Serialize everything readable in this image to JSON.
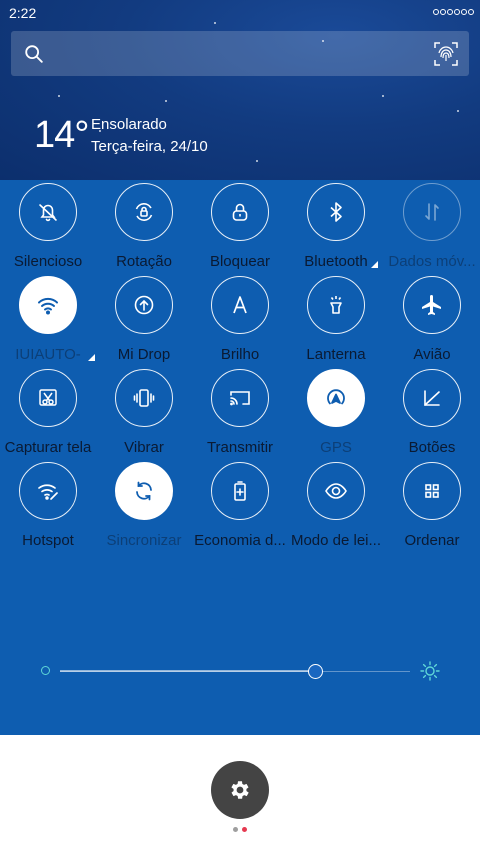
{
  "status_bar": {
    "time": "2:22"
  },
  "search": {
    "placeholder": ""
  },
  "weather": {
    "temperature": "14°",
    "condition": "Ensolarado",
    "date": "Terça-feira, 24/10"
  },
  "toggles": [
    {
      "label": "Silencioso",
      "icon": "bell-off-icon",
      "state": "off"
    },
    {
      "label": "Rotação",
      "icon": "rotation-lock-icon",
      "state": "off"
    },
    {
      "label": "Bloquear",
      "icon": "lock-icon",
      "state": "off"
    },
    {
      "label": "Bluetooth",
      "icon": "bluetooth-icon",
      "state": "off",
      "has_menu": true
    },
    {
      "label": "Dados móv...",
      "icon": "mobile-data-icon",
      "state": "disabled"
    },
    {
      "label": "IUIAUTO-",
      "icon": "wifi-icon",
      "state": "on",
      "has_menu": true
    },
    {
      "label": "Mi Drop",
      "icon": "mi-drop-icon",
      "state": "off"
    },
    {
      "label": "Brilho",
      "icon": "auto-brightness-icon",
      "state": "off"
    },
    {
      "label": "Lanterna",
      "icon": "flashlight-icon",
      "state": "off"
    },
    {
      "label": "Avião",
      "icon": "airplane-icon",
      "state": "off"
    },
    {
      "label": "Capturar tela",
      "icon": "screenshot-icon",
      "state": "off"
    },
    {
      "label": "Vibrar",
      "icon": "vibrate-icon",
      "state": "off"
    },
    {
      "label": "Transmitir",
      "icon": "cast-icon",
      "state": "off"
    },
    {
      "label": "GPS",
      "icon": "gps-icon",
      "state": "on"
    },
    {
      "label": "Botões",
      "icon": "buttons-icon",
      "state": "off"
    },
    {
      "label": "Hotspot",
      "icon": "hotspot-icon",
      "state": "off"
    },
    {
      "label": "Sincronizar",
      "icon": "sync-icon",
      "state": "on"
    },
    {
      "label": "Economia d...",
      "icon": "battery-saver-icon",
      "state": "off"
    },
    {
      "label": "Modo de lei...",
      "icon": "reading-mode-icon",
      "state": "off"
    },
    {
      "label": "Ordenar",
      "icon": "grid-icon",
      "state": "off"
    }
  ],
  "brightness": {
    "level": 0.73
  },
  "colors": {
    "panel": "#0e5db0",
    "active_toggle_icon": "#0e5db0",
    "settings_button": "#444444",
    "page_dot_inactive": "#9e9e9e",
    "page_dot_active": "#e53950"
  },
  "pager": {
    "page": 2,
    "total": 2
  }
}
